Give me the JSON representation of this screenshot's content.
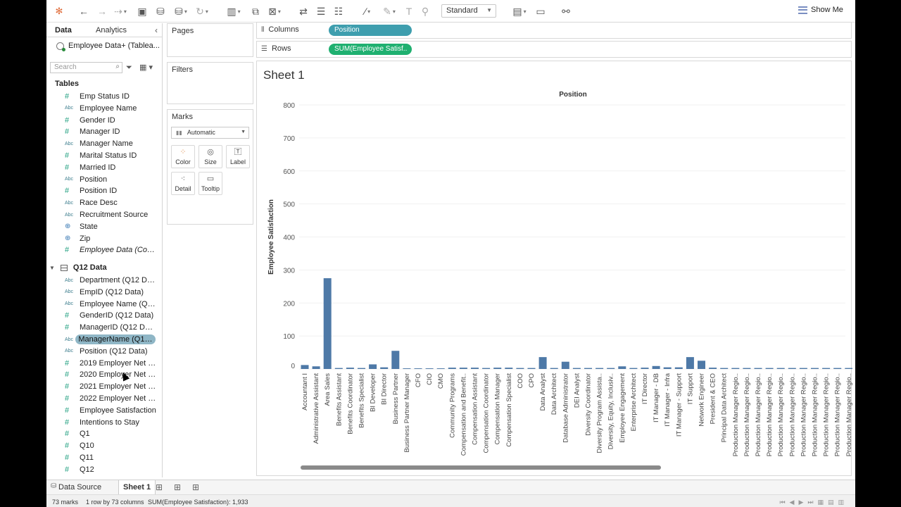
{
  "toolbar": {
    "view_mode": "Standard",
    "show_me": "Show Me"
  },
  "data_pane": {
    "tab_data": "Data",
    "tab_analytics": "Analytics",
    "datasource": "Employee Data+ (Tablea...",
    "search_placeholder": "Search",
    "tables_label": "Tables",
    "fields": [
      {
        "type": "num",
        "name": "Emp Status ID"
      },
      {
        "type": "abc",
        "name": "Employee Name"
      },
      {
        "type": "num",
        "name": "Gender ID"
      },
      {
        "type": "num",
        "name": "Manager ID"
      },
      {
        "type": "abc",
        "name": "Manager Name"
      },
      {
        "type": "num",
        "name": "Marital Status ID"
      },
      {
        "type": "num",
        "name": "Married ID"
      },
      {
        "type": "abc",
        "name": "Position"
      },
      {
        "type": "num",
        "name": "Position ID"
      },
      {
        "type": "abc",
        "name": "Race Desc"
      },
      {
        "type": "abc",
        "name": "Recruitment Source"
      },
      {
        "type": "geo",
        "name": "State"
      },
      {
        "type": "geo",
        "name": "Zip"
      },
      {
        "type": "num",
        "name": "Employee Data (Count)"
      }
    ],
    "q12_label": "Q12 Data",
    "q12_fields": [
      {
        "type": "abc",
        "name": "Department (Q12 Data)"
      },
      {
        "type": "abc",
        "name": "EmpID (Q12 Data)"
      },
      {
        "type": "abc",
        "name": "Employee Name (Q12 ..."
      },
      {
        "type": "num",
        "name": "GenderID (Q12 Data)"
      },
      {
        "type": "num",
        "name": "ManagerID (Q12 Data)"
      },
      {
        "type": "abc",
        "name": "ManagerName (Q12..."
      },
      {
        "type": "abc",
        "name": "Position (Q12 Data)"
      },
      {
        "type": "num",
        "name": "2019 Employer Net Pr..."
      },
      {
        "type": "num",
        "name": "2020 Employer Net Pr..."
      },
      {
        "type": "num",
        "name": "2021 Employer Net Pr..."
      },
      {
        "type": "num",
        "name": "2022 Employer Net Pr..."
      },
      {
        "type": "num",
        "name": "Employee Satisfaction"
      },
      {
        "type": "num",
        "name": "Intentions to Stay"
      },
      {
        "type": "num",
        "name": "Q1"
      },
      {
        "type": "num",
        "name": "Q10"
      },
      {
        "type": "num",
        "name": "Q11"
      },
      {
        "type": "num",
        "name": "Q12"
      }
    ]
  },
  "cards": {
    "pages": "Pages",
    "filters": "Filters",
    "marks": "Marks",
    "marks_type": "Automatic",
    "mark_buttons": [
      "Color",
      "Size",
      "Label",
      "Detail",
      "Tooltip"
    ]
  },
  "shelves": {
    "columns_label": "Columns",
    "columns_pill": "Position",
    "rows_label": "Rows",
    "rows_pill": "SUM(Employee Satisf.."
  },
  "sheet": {
    "title": "Sheet 1"
  },
  "chart_data": {
    "type": "bar",
    "title": "Position",
    "ylabel": "Employee Satisfaction",
    "ylim": [
      0,
      800
    ],
    "yticks": [
      0,
      100,
      200,
      300,
      400,
      500,
      600,
      700,
      800
    ],
    "bar_color": "#4e79a7",
    "categories": [
      "Accountant I",
      "Administrative Assistant",
      "Area Sales",
      "Benefits Assistant",
      "Benefits Coordinator",
      "Benefits Specialist",
      "BI Developer",
      "BI Director",
      "Business Partner",
      "Business Partner Manager",
      "CFO",
      "CIO",
      "CMO",
      "Community Programs",
      "Compensation and Benefit..",
      "Compensation Assistant",
      "Compensation Coordinator",
      "Compensation Manager",
      "Compensation Specialist",
      "COO",
      "CPO",
      "Data Analyst",
      "Data Architect",
      "Database Administrator",
      "DEI Analyst",
      "Diversity Coordinator",
      "Diversity Program Assista..",
      "Diversity, Equity, Inclusiv..",
      "Employee Engagement",
      "Enterprise Architect",
      "IT Director",
      "IT Manager - DB",
      "IT Manager - Infra",
      "IT Manager - Support",
      "IT Support",
      "Network Engineer",
      "President & CEO",
      "Principal Data Architect",
      "Production Manager Regio..",
      "Production Manager Regio..",
      "Production Manager Regio..",
      "Production Manager Regio..",
      "Production Manager Regio..",
      "Production Manager Regio..",
      "Production Manager Regio..",
      "Production Manager Regio..",
      "Production Manager Regio..",
      "Production Manager Regio..",
      "Production Manager Regio..",
      "Production Manager Regio.."
    ],
    "values": [
      12,
      8,
      275,
      3,
      4,
      3,
      14,
      5,
      55,
      2,
      2,
      2,
      2,
      4,
      4,
      4,
      3,
      4,
      4,
      3,
      3,
      36,
      3,
      22,
      3,
      3,
      3,
      3,
      8,
      3,
      4,
      9,
      5,
      5,
      36,
      25,
      4,
      3,
      3,
      3,
      3,
      3,
      3,
      3,
      3,
      3,
      3,
      3,
      3,
      3
    ]
  },
  "bottom_tabs": {
    "data_source": "Data Source",
    "sheet1": "Sheet 1"
  },
  "status": {
    "marks": "73 marks",
    "dims": "1 row by 73 columns",
    "sum": "SUM(Employee Satisfaction): 1,933"
  }
}
